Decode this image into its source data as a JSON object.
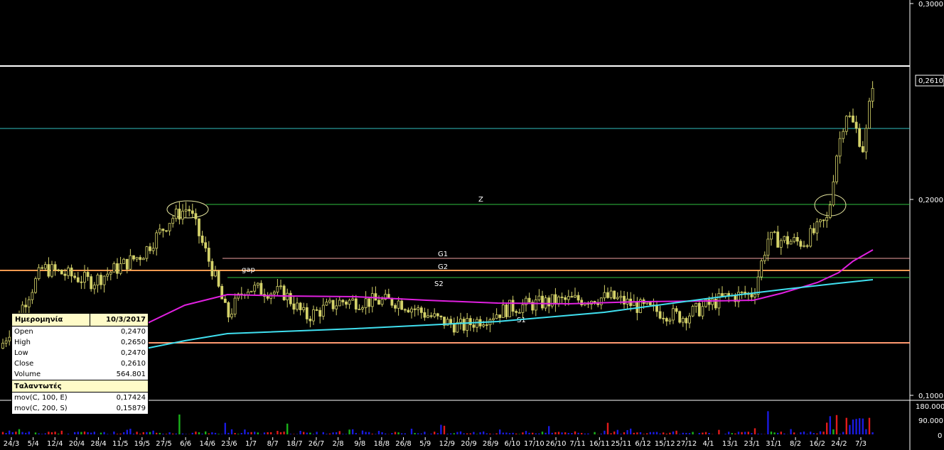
{
  "chart_data": {
    "type": "candlestick",
    "x_ticks": [
      "24/3",
      "5/4",
      "12/4",
      "20/4",
      "28/4",
      "11/5",
      "19/5",
      "27/5",
      "6/6",
      "14/6",
      "23/6",
      "1/7",
      "8/7",
      "18/7",
      "26/7",
      "2/8",
      "9/8",
      "18/8",
      "26/8",
      "5/9",
      "12/9",
      "20/9",
      "28/9",
      "6/10",
      "17/10",
      "26/10",
      "7/11",
      "16/11",
      "25/11",
      "6/12",
      "15/12",
      "27/12",
      "4/1",
      "13/1",
      "23/1",
      "31/1",
      "8/2",
      "16/2",
      "24/2",
      "7/3"
    ],
    "price_ticks": [
      "0,3000",
      "0,2000",
      "0,1000"
    ],
    "last_price_label": "0,2610",
    "volume_ticks": [
      "180.000",
      "90.000",
      "0"
    ],
    "price_range": [
      0.095,
      0.3
    ],
    "volume_range": [
      0,
      190000
    ],
    "series": [
      {
        "name": "mov(C, 100, E)",
        "color": "#e020e0"
      },
      {
        "name": "mov(C, 200, S)",
        "color": "#40e0f0"
      }
    ],
    "annotations": [
      "Z",
      "G1",
      "G2",
      "S2",
      "S1",
      "gap"
    ],
    "candle_color": "#d4d26a",
    "volume_colors": [
      "#1a1ae0",
      "#e01a1a",
      "#1ab01a"
    ]
  },
  "info_panel": {
    "date_label": "Ημερομηνία",
    "date_value": "10/3/2017",
    "rows": [
      {
        "k": "Open",
        "v": "0,2470"
      },
      {
        "k": "High",
        "v": "0,2650"
      },
      {
        "k": "Low",
        "v": "0,2470"
      },
      {
        "k": "Close",
        "v": "0,2610"
      },
      {
        "k": "Volume",
        "v": "564.801"
      }
    ],
    "indicators_label": "Ταλαντωτές",
    "indicators": [
      {
        "k": "mov(C, 100, E)",
        "v": "0,17424"
      },
      {
        "k": "mov(C, 200, S)",
        "v": "0,15879"
      }
    ]
  }
}
